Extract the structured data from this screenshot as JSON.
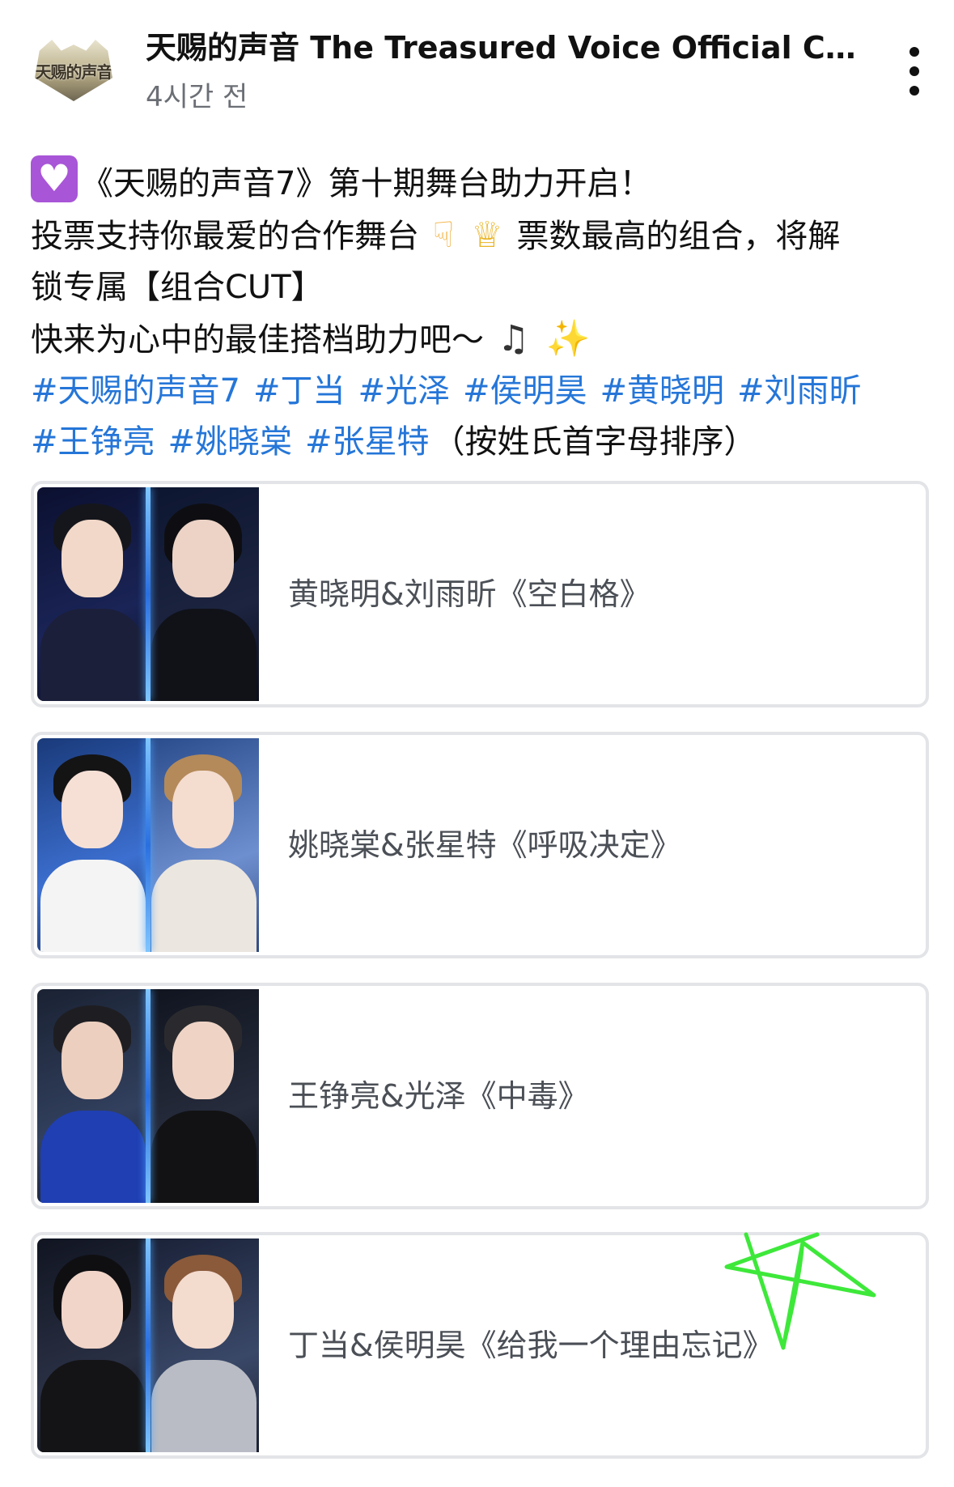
{
  "header": {
    "channel_name": "天赐的声音 The Treasured Voice Official Ch...",
    "time_ago": "4시간 전",
    "avatar_text": "天赐的声音",
    "more_icon": "more-vertical-icon"
  },
  "post": {
    "line1_text": "《天赐的声音7》第十期舞台助力开启！",
    "line2_text_a": "投票支持你最爱的合作舞台",
    "line2_text_b": "票数最高的组合，将解",
    "line3_text": "锁专属【组合CUT】",
    "line4_text": "快来为心中的最佳搭档助力吧～",
    "hashtags": [
      "#天赐的声音7",
      "#丁当",
      "#光泽",
      "#侯明昊",
      "#黄晓明",
      "#刘雨昕",
      "#王铮亮",
      "#姚晓棠",
      "#张星特"
    ],
    "sort_note": "（按姓氏首字母排序）"
  },
  "poll_options": [
    {
      "label": "黄晓明&刘雨昕《空白格》"
    },
    {
      "label": "姚晓棠&张星特《呼吸决定》"
    },
    {
      "label": "王铮亮&光泽《中毒》"
    },
    {
      "label": "丁当&侯明昊《给我一个理由忘记》"
    }
  ],
  "colors": {
    "hashtag": "#2576d8",
    "card_border": "#e3e4e7",
    "card_text": "#4b4f56",
    "doodle": "#3ee83a"
  }
}
